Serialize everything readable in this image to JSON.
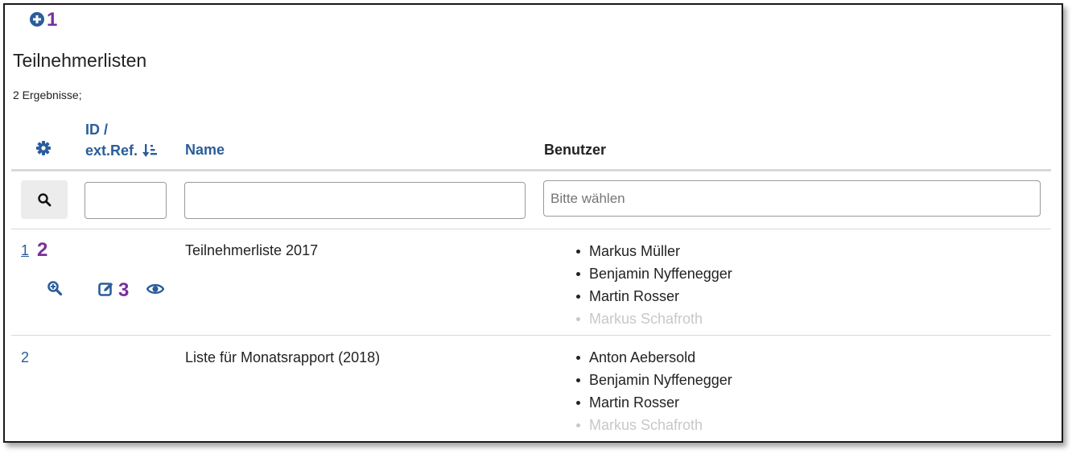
{
  "annotations": {
    "a1": "1",
    "a2": "2",
    "a3": "3"
  },
  "page": {
    "title": "Teilnehmerlisten",
    "result_count": "2 Ergebnisse;"
  },
  "table": {
    "headers": {
      "id_line1": "ID /",
      "id_line2": "ext.Ref.",
      "name": "Name",
      "users": "Benutzer"
    },
    "filters": {
      "users_placeholder": "Bitte wählen"
    },
    "rows": [
      {
        "id": "1",
        "name": "Teilnehmerliste 2017",
        "users": [
          "Markus Müller",
          "Benjamin Nyffenegger",
          "Martin Rosser",
          "Markus Schafroth"
        ]
      },
      {
        "id": "2",
        "name": "Liste für Monatsrapport (2018)",
        "users": [
          "Anton Aebersold",
          "Benjamin Nyffenegger",
          "Martin Rosser",
          "Markus Schafroth"
        ]
      }
    ]
  },
  "colors": {
    "link": "#2a5d9a",
    "annotation": "#7a2f9c",
    "faded": "#c8c8c8"
  },
  "icons": [
    "plus-circle-icon",
    "gear-icon",
    "sort-desc-icon",
    "search-icon",
    "zoom-in-icon",
    "edit-icon",
    "eye-icon"
  ]
}
